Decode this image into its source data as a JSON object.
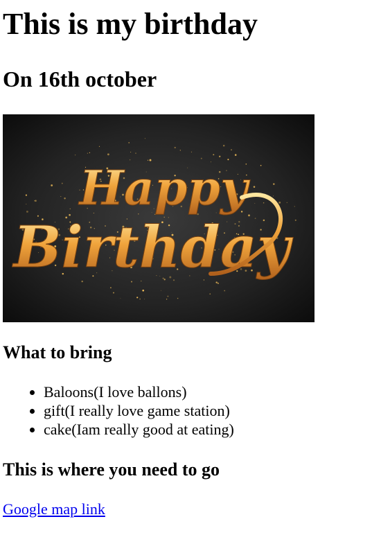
{
  "page": {
    "title": "This is my birthday",
    "subtitle": "On 16th october",
    "banner": {
      "alt": "Happy Birthday",
      "line1": "Happy",
      "line2": "Birthday",
      "colors": {
        "background": "#222222",
        "lettering": "#f0a43c",
        "lettering_highlight": "#ffe8a0",
        "sparkle": "#f5c15a"
      }
    },
    "bring_heading": "What to bring",
    "bring_items": [
      "Baloons(I love ballons)",
      "gift(I really love game station)",
      "cake(Iam really good at eating)"
    ],
    "where_heading": "This is where you need to go",
    "map_link": "Google map link",
    "link_color": "#0000ee"
  }
}
